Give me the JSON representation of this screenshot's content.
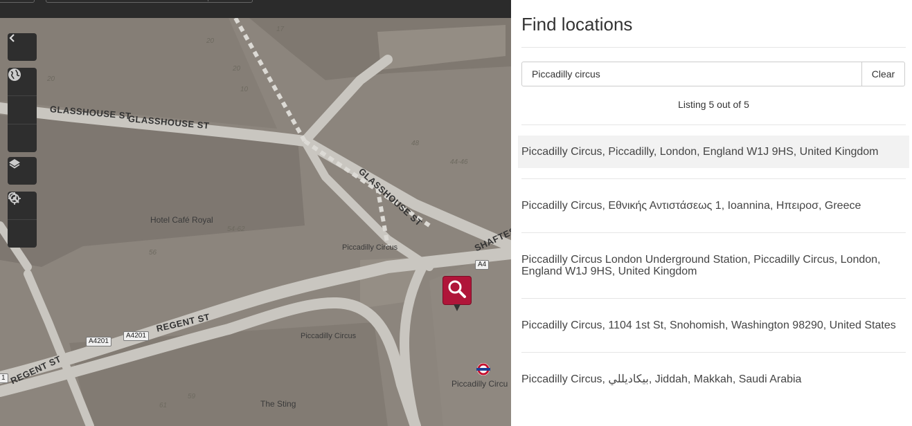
{
  "colors": {
    "marker": "#b01539",
    "panel_bg": "#ffffff",
    "highlight": "#f2f2f2",
    "map_overlay": "#8a8580"
  },
  "map": {
    "labels": {
      "glasshouse_st_1": "GLASSHOUSE ST",
      "glasshouse_st_2": "GLASSHOUSE ST",
      "glasshouse_st_3": "GLASSHOUSE ST",
      "hotel_cafe_royal": "Hotel Café Royal",
      "piccadilly_circus_1": "Piccadilly Circus",
      "piccadilly_circus_2": "Piccadilly Circus",
      "piccadilly_circus_3": "Piccadilly Circu",
      "regent_st_1": "REGENT ST",
      "regent_st_2": "REGENT ST",
      "shaftes": "SHAFTES",
      "the_sting": "The Sting",
      "a4": "A4",
      "a4201_1": "A4201",
      "a4201_2": "A4201",
      "edge_1": "1"
    },
    "numbers": [
      "17",
      "20",
      "20",
      "20",
      "10",
      "48",
      "44-46",
      "54-62",
      "56",
      "61",
      "59"
    ]
  },
  "controls": {
    "icons": [
      "chevron-left-icon",
      "zoom-in-icon",
      "zoom-out-icon",
      "globe-icon",
      "layers-icon",
      "locate-icon",
      "search-icon"
    ]
  },
  "panel": {
    "title": "Find locations",
    "search": {
      "value": "Piccadilly circus",
      "placeholder": ""
    },
    "clear_label": "Clear",
    "listing": "Listing 5 out of 5",
    "results": [
      "Piccadilly Circus, Piccadilly, London, England W1J 9HS, United Kingdom",
      "Piccadilly Circus, Εθνικής Αντιστάσεως 1, Ioannina, Ηπειροσ, Greece",
      "Piccadilly Circus London Underground Station, Piccadilly Circus, London, England W1J 9HS, United Kingdom",
      "Piccadilly Circus, 1104 1st St, Snohomish, Washington 98290, United States",
      "Piccadilly Circus, بيكاديللي, Jiddah, Makkah, Saudi Arabia"
    ]
  }
}
